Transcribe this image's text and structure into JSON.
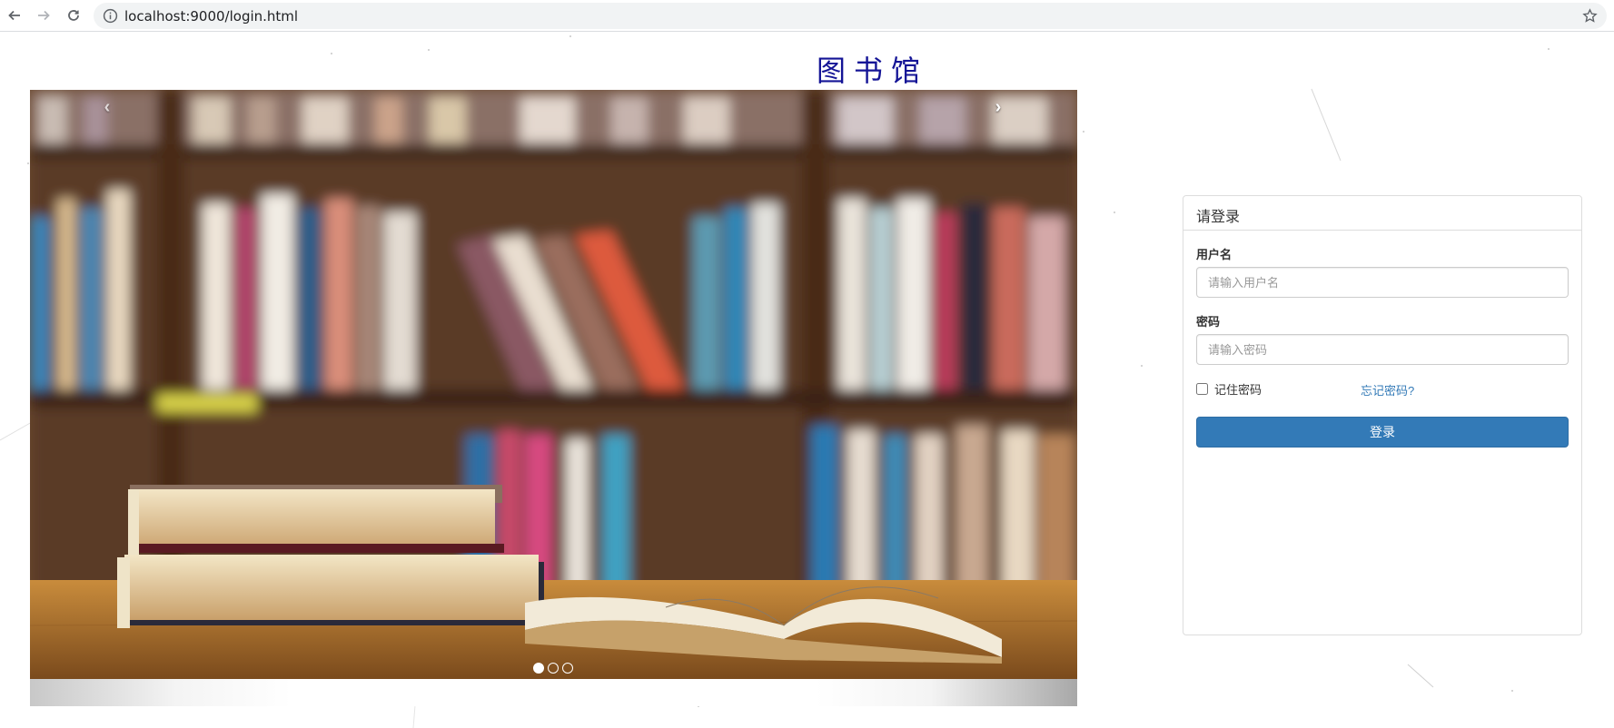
{
  "browser": {
    "url": "localhost:9000/login.html",
    "icons": [
      "back-arrow-icon",
      "forward-arrow-icon",
      "reload-icon",
      "info-icon",
      "star-icon"
    ]
  },
  "page": {
    "title": "图书馆"
  },
  "carousel": {
    "prev_label": "‹",
    "next_label": "›",
    "slide_count": 3,
    "active_index": 0,
    "image_description_hidden": true
  },
  "login": {
    "heading": "请登录",
    "username_label": "用户名",
    "username_placeholder": "请输入用户名",
    "username_value": "",
    "password_label": "密码",
    "password_placeholder": "请输入密码",
    "password_value": "",
    "remember_label": "记住密码",
    "remember_checked": false,
    "forgot_label": "忘记密码?",
    "submit_label": "登录"
  },
  "colors": {
    "title": "#141496",
    "primary": "#337ab7",
    "link": "#337ab7",
    "border": "#dddddd"
  }
}
